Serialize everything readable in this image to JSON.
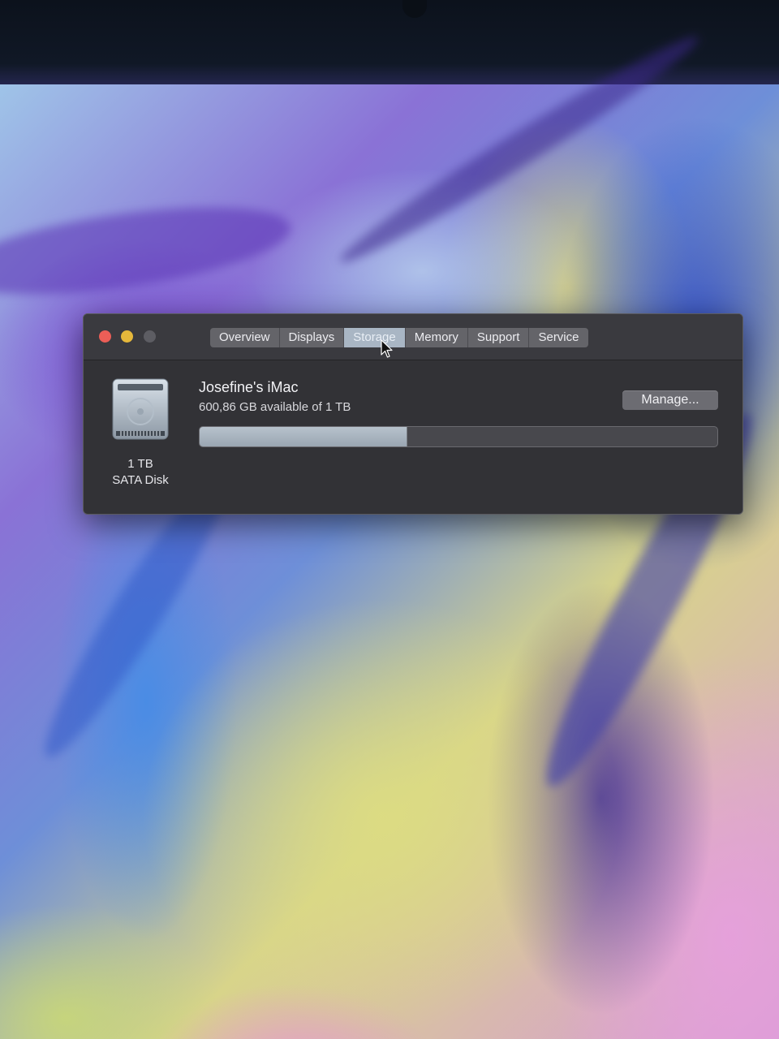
{
  "tabs": [
    {
      "label": "Overview",
      "active": false
    },
    {
      "label": "Displays",
      "active": false
    },
    {
      "label": "Storage",
      "active": true
    },
    {
      "label": "Memory",
      "active": false
    },
    {
      "label": "Support",
      "active": false
    },
    {
      "label": "Service",
      "active": false
    }
  ],
  "window_controls": {
    "close_color": "#ec5e57",
    "minimize_color": "#e6b83b",
    "zoom_color": "#5d5d63"
  },
  "disk": {
    "icon": "hard-drive-icon",
    "size": "1 TB",
    "type": "SATA Disk",
    "name": "Josefine's iMac",
    "available_text": "600,86 GB available of 1 TB",
    "used_fraction": 0.4
  },
  "manage_button": {
    "label": "Manage..."
  }
}
